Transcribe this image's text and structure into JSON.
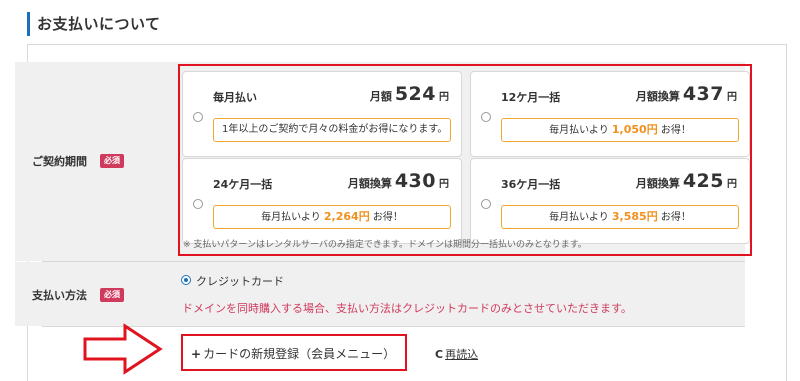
{
  "section": {
    "title": "お支払いについて"
  },
  "contract": {
    "label": "ご契約期間",
    "required": "必須",
    "plans": [
      {
        "name": "毎月払い",
        "price_prefix": "月額",
        "price": "524",
        "yen": "円",
        "note": "1年以上のご契約で月々の料金がお得になります。"
      },
      {
        "name": "12ケ月一括",
        "price_prefix": "月額換算",
        "price": "437",
        "yen": "円",
        "note_prefix": "毎月払いより",
        "saving": "1,050円",
        "note_suffix": "お得！"
      },
      {
        "name": "24ケ月一括",
        "price_prefix": "月額換算",
        "price": "430",
        "yen": "円",
        "note_prefix": "毎月払いより",
        "saving": "2,264円",
        "note_suffix": "お得！"
      },
      {
        "name": "36ケ月一括",
        "price_prefix": "月額換算",
        "price": "425",
        "yen": "円",
        "note_prefix": "毎月払いより",
        "saving": "3,585円",
        "note_suffix": "お得！"
      }
    ],
    "footnote": "※ 支払いパターンはレンタルサーバのみ指定できます。ドメインは期間分一括払いのみとなります。"
  },
  "payment": {
    "label": "支払い方法",
    "required": "必須",
    "method": "クレジットカード",
    "note": "ドメインを同時購入する場合、支払い方法はクレジットカードのみとさせていただきます。"
  },
  "card": {
    "plus": "+",
    "add_label": "カードの新規登録（会員メニュー）",
    "reload_icon": "C",
    "reload_label": "再読込"
  },
  "colors": {
    "accent": "#1a6fb5",
    "highlight_frame": "#e0141e",
    "required_badge": "#d03a5c",
    "saving": "#f0901e"
  }
}
